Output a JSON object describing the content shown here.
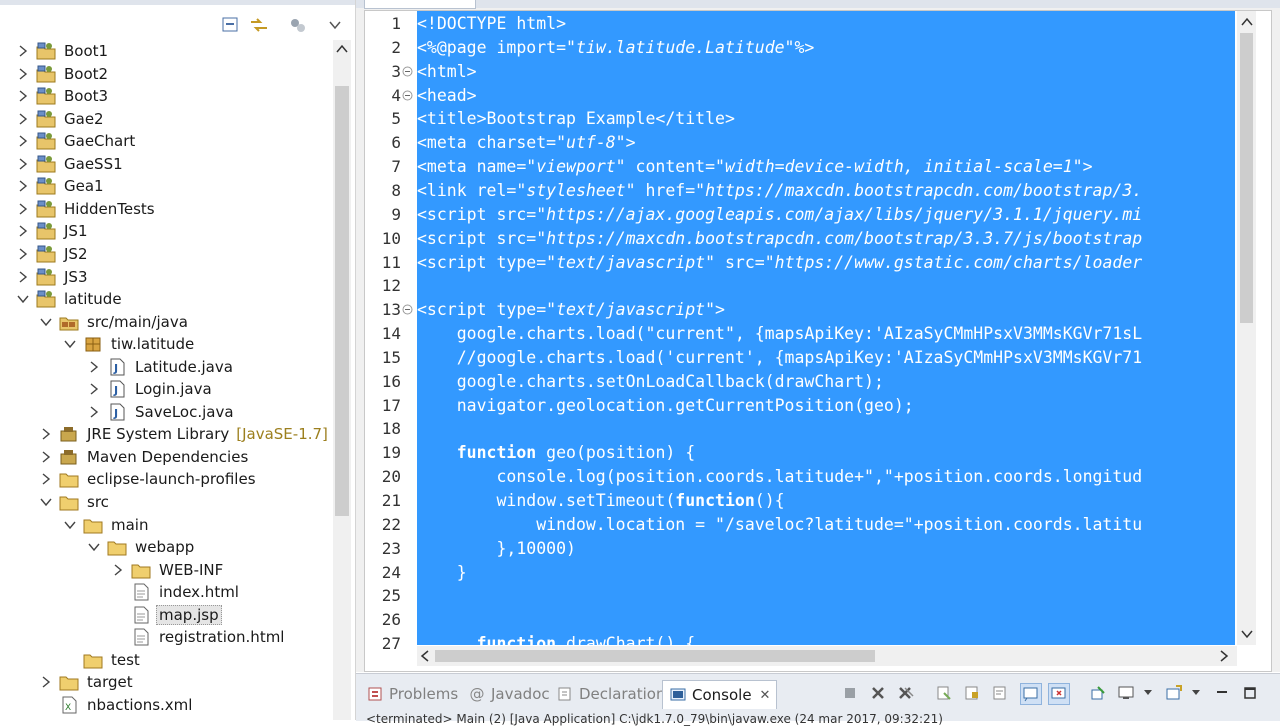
{
  "explorer": {
    "items": [
      {
        "label": "Boot1",
        "icon": "project-icon"
      },
      {
        "label": "Boot2",
        "icon": "project-icon"
      },
      {
        "label": "Boot3",
        "icon": "project-icon"
      },
      {
        "label": "Gae2",
        "icon": "project-icon"
      },
      {
        "label": "GaeChart",
        "icon": "project-icon"
      },
      {
        "label": "GaeSS1",
        "icon": "project-icon"
      },
      {
        "label": "Gea1",
        "icon": "project-icon"
      },
      {
        "label": "HiddenTests",
        "icon": "project-icon"
      },
      {
        "label": "JS1",
        "icon": "project-icon"
      },
      {
        "label": "JS2",
        "icon": "project-icon"
      },
      {
        "label": "JS3",
        "icon": "project-icon"
      },
      {
        "label": "latitude",
        "icon": "project-icon"
      },
      {
        "label": "src/main/java",
        "icon": "source-folder-icon"
      },
      {
        "label": "tiw.latitude",
        "icon": "package-icon"
      },
      {
        "label": "Latitude.java",
        "icon": "java-file-icon"
      },
      {
        "label": "Login.java",
        "icon": "java-file-icon"
      },
      {
        "label": "SaveLoc.java",
        "icon": "java-file-icon"
      },
      {
        "label": "JRE System Library",
        "decoration": "[JavaSE-1.7]",
        "icon": "library-icon"
      },
      {
        "label": "Maven Dependencies",
        "icon": "library-icon"
      },
      {
        "label": "eclipse-launch-profiles",
        "icon": "folder-icon"
      },
      {
        "label": "src",
        "icon": "folder-icon"
      },
      {
        "label": "main",
        "icon": "folder-icon"
      },
      {
        "label": "webapp",
        "icon": "folder-icon"
      },
      {
        "label": "WEB-INF",
        "icon": "folder-icon"
      },
      {
        "label": "index.html",
        "icon": "file-icon"
      },
      {
        "label": "map.jsp",
        "icon": "file-icon"
      },
      {
        "label": "registration.html",
        "icon": "file-icon"
      },
      {
        "label": "test",
        "icon": "folder-icon"
      },
      {
        "label": "target",
        "icon": "folder-icon"
      },
      {
        "label": "nbactions.xml",
        "icon": "xml-file-icon"
      }
    ]
  },
  "editor": {
    "line_numbers": [
      "1",
      "2",
      "3",
      "4",
      "5",
      "6",
      "7",
      "8",
      "9",
      "10",
      "11",
      "12",
      "13",
      "14",
      "15",
      "16",
      "17",
      "18",
      "19",
      "20",
      "21",
      "22",
      "23",
      "24",
      "25",
      "26",
      "27"
    ],
    "code_lines": [
      [
        {
          "t": "<!DOCTYPE html>",
          "c": ""
        }
      ],
      [
        {
          "t": "<%@page import=",
          "c": ""
        },
        {
          "t": "\"tiw.latitude.Latitude\"",
          "c": "str"
        },
        {
          "t": "%>",
          "c": ""
        }
      ],
      [
        {
          "t": "<html>",
          "c": ""
        }
      ],
      [
        {
          "t": "<head>",
          "c": ""
        }
      ],
      [
        {
          "t": "<title>Bootstrap Example</title>",
          "c": ""
        }
      ],
      [
        {
          "t": "<meta charset=",
          "c": ""
        },
        {
          "t": "\"utf-8\"",
          "c": "str"
        },
        {
          "t": ">",
          "c": ""
        }
      ],
      [
        {
          "t": "<meta name=",
          "c": ""
        },
        {
          "t": "\"viewport\"",
          "c": "str"
        },
        {
          "t": " content=",
          "c": ""
        },
        {
          "t": "\"width=device-width, initial-scale=1\"",
          "c": "str"
        },
        {
          "t": ">",
          "c": ""
        }
      ],
      [
        {
          "t": "<link rel=",
          "c": ""
        },
        {
          "t": "\"stylesheet\"",
          "c": "str"
        },
        {
          "t": " href=",
          "c": ""
        },
        {
          "t": "\"https://maxcdn.bootstrapcdn.com/bootstrap/3.",
          "c": "str"
        }
      ],
      [
        {
          "t": "<script src=",
          "c": ""
        },
        {
          "t": "\"https://ajax.googleapis.com/ajax/libs/jquery/3.1.1/jquery.mi",
          "c": "str"
        }
      ],
      [
        {
          "t": "<script src=",
          "c": ""
        },
        {
          "t": "\"https://maxcdn.bootstrapcdn.com/bootstrap/3.3.7/js/bootstrap",
          "c": "str"
        }
      ],
      [
        {
          "t": "<script type=",
          "c": ""
        },
        {
          "t": "\"text/javascript\"",
          "c": "str"
        },
        {
          "t": " src=",
          "c": ""
        },
        {
          "t": "\"https://www.gstatic.com/charts/loader",
          "c": "str"
        }
      ],
      [
        {
          "t": "",
          "c": ""
        }
      ],
      [
        {
          "t": "<script type=",
          "c": ""
        },
        {
          "t": "\"text/javascript\"",
          "c": "str"
        },
        {
          "t": ">",
          "c": ""
        }
      ],
      [
        {
          "t": "    google.charts.load(\"current\", {mapsApiKey:'AIzaSyCMmHPsxV3MMsKGVr71sL",
          "c": ""
        }
      ],
      [
        {
          "t": "    //google.charts.load('current', {mapsApiKey:'AIzaSyCMmHPsxV3MMsKGVr71",
          "c": ""
        }
      ],
      [
        {
          "t": "    google.charts.setOnLoadCallback(drawChart);",
          "c": ""
        }
      ],
      [
        {
          "t": "    navigator.geolocation.getCurrentPosition(geo);",
          "c": ""
        }
      ],
      [
        {
          "t": "",
          "c": ""
        }
      ],
      [
        {
          "t": "    ",
          "c": ""
        },
        {
          "t": "function",
          "c": "kw"
        },
        {
          "t": " geo(position) {",
          "c": ""
        }
      ],
      [
        {
          "t": "        console.log(position.coords.latitude+\",\"+position.coords.longitud",
          "c": ""
        }
      ],
      [
        {
          "t": "        window.setTimeout(",
          "c": ""
        },
        {
          "t": "function",
          "c": "kw"
        },
        {
          "t": "(){",
          "c": ""
        }
      ],
      [
        {
          "t": "            window.location = \"/saveloc?latitude=\"+position.coords.latitu",
          "c": ""
        }
      ],
      [
        {
          "t": "        },10000)",
          "c": ""
        }
      ],
      [
        {
          "t": "    }",
          "c": ""
        }
      ],
      [
        {
          "t": "",
          "c": ""
        }
      ],
      [
        {
          "t": "",
          "c": ""
        }
      ],
      [
        {
          "t": "      ",
          "c": ""
        },
        {
          "t": "function",
          "c": "kw"
        },
        {
          "t": " drawChart() {",
          "c": ""
        }
      ]
    ]
  },
  "bottom": {
    "tabs": [
      "Problems",
      "Javadoc",
      "Declaration",
      "Console"
    ],
    "close_glyph": "✕",
    "console_text": "<terminated> Main (2) [Java Application] C:\\jdk1.7.0_79\\bin\\javaw.exe (24 mar 2017, 09:32:21)"
  },
  "colors": {
    "selection": "#3399ff",
    "editor_bg": "#ffffff"
  }
}
